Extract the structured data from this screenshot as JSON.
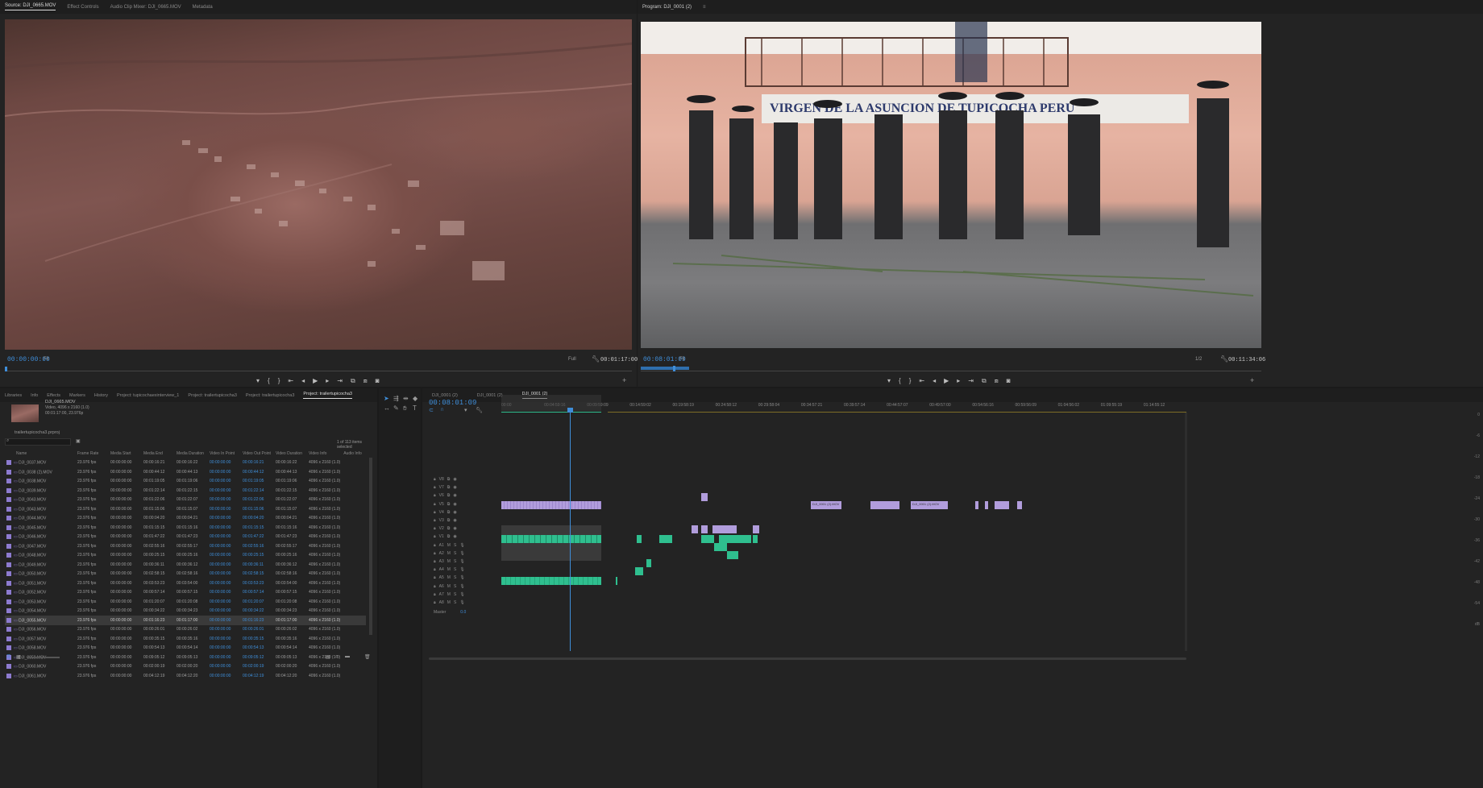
{
  "source_panel": {
    "tabs": [
      "Source: DJI_0665.MOV",
      "Effect Controls",
      "Audio Clip Mixer: DJI_0665.MOV",
      "Metadata"
    ],
    "timecode": "00:00:00:00",
    "fit": "Fit",
    "quality": "Full",
    "duration": "00:01:17:00"
  },
  "program_panel": {
    "title": "Program: DJI_0001 (2)",
    "timecode": "00:08:01:09",
    "fit": "Fit",
    "quality": "1/2",
    "duration": "00:11:34:06"
  },
  "project_panel": {
    "tabs": [
      "Libraries",
      "Info",
      "Effects",
      "Markers",
      "History",
      "Project: tupicochaexinterview_1",
      "Project: trailertupicocha3",
      "Project: trailertupicocha3",
      "Project: trailertupicocha3"
    ],
    "active_tab": "Project: trailertupicocha3",
    "clip_name": "DJI_0665.MOV",
    "clip_info1": "Video, 4096 x 2160 (1.0)",
    "clip_info2": "00:01:17:00, 23.976p",
    "project_file": "trailertupicocha3.prproj",
    "items_selected": "1 of 113 items selected",
    "columns": [
      "Name",
      "Frame Rate",
      "Media Start",
      "Media End",
      "Media Duration",
      "Video In Point",
      "Video Out Point",
      "Video Duration",
      "Video Info",
      "Audio Info"
    ],
    "rows": [
      [
        "DJI_0037.MOV",
        "23.976 fps",
        "00:00:00:00",
        "00:00:16:21",
        "00:00:16:22",
        "00:00:00:00",
        "00:00:16:21",
        "00:00:16:22",
        "4096 x 2160 (1.0)",
        ""
      ],
      [
        "DJI_0038 (2).MOV",
        "23.976 fps",
        "00:00:00:00",
        "00:00:44:12",
        "00:00:44:13",
        "00:00:00:00",
        "00:00:44:12",
        "00:00:44:13",
        "4096 x 2160 (1.0)",
        ""
      ],
      [
        "DJI_0038.MOV",
        "23.976 fps",
        "00:00:00:00",
        "00:01:19:05",
        "00:01:19:06",
        "00:00:00:00",
        "00:01:19:05",
        "00:01:19:06",
        "4096 x 2160 (1.0)",
        ""
      ],
      [
        "DJI_0039.MOV",
        "23.976 fps",
        "00:00:00:00",
        "00:01:22:14",
        "00:01:22:15",
        "00:00:00:00",
        "00:01:22:14",
        "00:01:22:15",
        "4096 x 2160 (1.0)",
        ""
      ],
      [
        "DJI_0043.MOV",
        "23.976 fps",
        "00:00:00:00",
        "00:01:22:06",
        "00:01:22:07",
        "00:00:00:00",
        "00:01:22:06",
        "00:01:22:07",
        "4096 x 2160 (1.0)",
        ""
      ],
      [
        "DJI_0043.MOV",
        "23.976 fps",
        "00:00:00:00",
        "00:01:15:06",
        "00:01:15:07",
        "00:00:00:00",
        "00:01:15:06",
        "00:01:15:07",
        "4096 x 2160 (1.0)",
        ""
      ],
      [
        "DJI_0044.MOV",
        "23.976 fps",
        "00:00:00:00",
        "00:00:04:20",
        "00:00:04:21",
        "00:00:00:00",
        "00:00:04:20",
        "00:00:04:21",
        "4096 x 2160 (1.0)",
        ""
      ],
      [
        "DJI_0045.MOV",
        "23.976 fps",
        "00:00:00:00",
        "00:01:15:15",
        "00:01:15:16",
        "00:00:00:00",
        "00:01:15:15",
        "00:01:15:16",
        "4096 x 2160 (1.0)",
        ""
      ],
      [
        "DJI_0046.MOV",
        "23.976 fps",
        "00:00:00:00",
        "00:01:47:22",
        "00:01:47:23",
        "00:00:00:00",
        "00:01:47:22",
        "00:01:47:23",
        "4096 x 2160 (1.0)",
        ""
      ],
      [
        "DJI_0047.MOV",
        "23.976 fps",
        "00:00:00:00",
        "00:02:55:16",
        "00:02:55:17",
        "00:00:00:00",
        "00:02:55:16",
        "00:02:55:17",
        "4096 x 2160 (1.0)",
        ""
      ],
      [
        "DJI_0048.MOV",
        "23.976 fps",
        "00:00:00:00",
        "00:00:25:15",
        "00:00:25:16",
        "00:00:00:00",
        "00:00:25:15",
        "00:00:25:16",
        "4096 x 2160 (1.0)",
        ""
      ],
      [
        "DJI_0049.MOV",
        "23.976 fps",
        "00:00:00:00",
        "00:00:36:11",
        "00:00:36:12",
        "00:00:00:00",
        "00:00:36:11",
        "00:00:36:12",
        "4096 x 2160 (1.0)",
        ""
      ],
      [
        "DJI_0050.MOV",
        "23.976 fps",
        "00:00:00:00",
        "00:02:58:15",
        "00:02:58:16",
        "00:00:00:00",
        "00:02:58:15",
        "00:02:58:16",
        "4096 x 2160 (1.0)",
        ""
      ],
      [
        "DJI_0051.MOV",
        "23.976 fps",
        "00:00:00:00",
        "00:03:53:23",
        "00:03:54:00",
        "00:00:00:00",
        "00:03:53:23",
        "00:03:54:00",
        "4096 x 2160 (1.0)",
        ""
      ],
      [
        "DJI_0052.MOV",
        "23.976 fps",
        "00:00:00:00",
        "00:00:57:14",
        "00:00:57:15",
        "00:00:00:00",
        "00:00:57:14",
        "00:00:57:15",
        "4096 x 2160 (1.0)",
        ""
      ],
      [
        "DJI_0053.MOV",
        "23.976 fps",
        "00:00:00:00",
        "00:01:20:07",
        "00:01:20:08",
        "00:00:00:00",
        "00:01:20:07",
        "00:01:20:08",
        "4096 x 2160 (1.0)",
        ""
      ],
      [
        "DJI_0054.MOV",
        "23.976 fps",
        "00:00:00:00",
        "00:00:34:22",
        "00:00:34:23",
        "00:00:00:00",
        "00:00:34:22",
        "00:00:34:23",
        "4096 x 2160 (1.0)",
        ""
      ],
      [
        "DJI_0055.MOV",
        "23.976 fps",
        "00:00:00:00",
        "00:01:16:23",
        "00:01:17:00",
        "00:00:00:00",
        "00:01:16:23",
        "00:01:17:00",
        "4096 x 2160 (1.0)",
        ""
      ],
      [
        "DJI_0056.MOV",
        "23.976 fps",
        "00:00:00:00",
        "00:00:26:01",
        "00:00:26:02",
        "00:00:00:00",
        "00:00:26:01",
        "00:00:26:02",
        "4096 x 2160 (1.0)",
        ""
      ],
      [
        "DJI_0057.MOV",
        "23.976 fps",
        "00:00:00:00",
        "00:00:35:15",
        "00:00:35:16",
        "00:00:00:00",
        "00:00:35:15",
        "00:00:35:16",
        "4096 x 2160 (1.0)",
        ""
      ],
      [
        "DJI_0058.MOV",
        "23.976 fps",
        "00:00:00:00",
        "00:00:54:13",
        "00:00:54:14",
        "00:00:00:00",
        "00:00:54:13",
        "00:00:54:14",
        "4096 x 2160 (1.0)",
        ""
      ],
      [
        "DJI_0059.MOV",
        "23.976 fps",
        "00:00:00:00",
        "00:09:05:12",
        "00:09:05:13",
        "00:00:00:00",
        "00:09:05:12",
        "00:09:05:13",
        "4096 x 2160 (1.0)",
        ""
      ],
      [
        "DJI_0060.MOV",
        "23.976 fps",
        "00:00:00:00",
        "00:02:00:19",
        "00:02:00:20",
        "00:00:00:00",
        "00:02:00:19",
        "00:02:00:20",
        "4096 x 2160 (1.0)",
        ""
      ],
      [
        "DJI_0061.MOV",
        "23.976 fps",
        "00:00:00:00",
        "00:04:12:19",
        "00:04:12:20",
        "00:00:00:00",
        "00:04:12:19",
        "00:04:12:20",
        "4096 x 2160 (1.0)",
        ""
      ]
    ],
    "selected_row": 17
  },
  "timeline": {
    "tabs": [
      "DJI_0001 (2)",
      "DJI_0001 (2)",
      "DJI_0001 (2)"
    ],
    "timecode": "00:08:01:09",
    "ruler": [
      "00:00",
      "00:04:59:16",
      "00:09:59:09",
      "00:14:59:02",
      "00:19:58:19",
      "00:24:58:12",
      "00:29:58:04",
      "00:34:57:21",
      "00:39:57:14",
      "00:44:57:07",
      "00:49:57:00",
      "00:54:56:16",
      "00:59:56:09",
      "01:04:56:02",
      "01:09:55:19",
      "01:14:55:12"
    ],
    "video_tracks": [
      "V8",
      "V7",
      "V6",
      "V5",
      "V4",
      "V3",
      "V2",
      "V1"
    ],
    "audio_tracks": [
      "A1",
      "A2",
      "A3",
      "A4",
      "A5",
      "A6",
      "A7",
      "A8"
    ],
    "master_label": "Master",
    "master_value": "0.0",
    "clip_labels": [
      "DJI_0001 (2).MOV",
      "DJI_0001 (2).MOV"
    ]
  },
  "meter_scale": [
    "0",
    "-6",
    "-12",
    "-18",
    "-24",
    "-30",
    "-36",
    "-42",
    "-48",
    "-54",
    "dB"
  ]
}
